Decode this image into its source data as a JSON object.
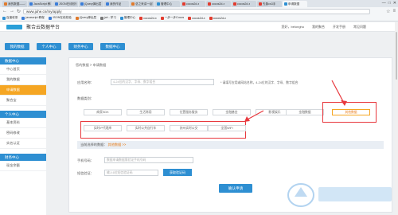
{
  "browser": {
    "tabs": [
      {
        "label": "我的数据——免费在",
        "color": "#e07a2c"
      },
      {
        "label": "JavaScript 教程",
        "color": "#3b7dd8"
      },
      {
        "label": "JSON在线校验",
        "color": "#3b7dd8"
      },
      {
        "label": "jQuery弹出层",
        "color": "#3b7dd8"
      },
      {
        "label": "我的作品",
        "color": "#3b7dd8"
      },
      {
        "label": "总之来讲一起",
        "color": "#e07a2c"
      },
      {
        "label": "管理中心",
        "color": "#2e8fd2"
      },
      {
        "label": "cocos2d-x",
        "color": "#e23b2e"
      },
      {
        "label": "cocos2d-x",
        "color": "#e23b2e"
      },
      {
        "label": "cocos2d-x",
        "color": "#e23b2e"
      },
      {
        "label": "先象cs3手",
        "color": "#e23b2e"
      },
      {
        "label": "申请数据",
        "color": "#2e8fd2"
      }
    ],
    "window_controls": [
      "—",
      "□",
      "✕"
    ],
    "url": "www.juhe.cn/my/apply",
    "bookmarks": [
      {
        "label": "百度收录",
        "color": "#2e8fd2"
      },
      {
        "label": "javascript 教程",
        "color": "#3b7dd8"
      },
      {
        "label": "JSON在线校验",
        "color": "#3b7dd8"
      },
      {
        "label": "jQuery弹出层",
        "color": "#e07a2c"
      },
      {
        "label": "jwt - 学习",
        "color": "#777"
      },
      {
        "label": "管理中心",
        "color": "#2e8fd2"
      },
      {
        "label": "cocos2d-x",
        "color": "#e23b2e"
      },
      {
        "label": "一步一步Cocos",
        "color": "#e23b2e"
      },
      {
        "label": "cocos2d-x",
        "color": "#e23b2e"
      },
      {
        "label": "cocos2d-x",
        "color": "#e23b2e"
      }
    ]
  },
  "site": {
    "name": "聚合云数据平台",
    "user_nav": [
      "您好，belonghu",
      "我的聚合",
      "开发手册",
      "常见问题"
    ]
  },
  "mainnav": [
    "我的数据",
    "个人中心",
    "财务中心",
    "数据中心"
  ],
  "sidebar": {
    "groups": [
      {
        "title": "数据中心",
        "items": [
          "中心首页",
          "我的数据",
          "申请数据",
          "聚合宝"
        ],
        "active": 2
      },
      {
        "title": "个人中心",
        "items": [
          "基本资料",
          "密码修改",
          "实名认证"
        ],
        "active": -1
      },
      {
        "title": "财务中心",
        "items": [
          "现金余额"
        ],
        "active": -1
      }
    ]
  },
  "content": {
    "breadcrumb": "您的数据 > 申请数据",
    "app_name_label": "应用名称：",
    "app_name_placeholder": "4-24位的汉字、字母、数字组合",
    "app_name_hint": "* 请填写应用或网站名称，4-24位的汉字、字母、数字组合",
    "category_label": "数据类别：",
    "categories_row1": [
      "商家SDK",
      "生活常用",
      "位置服务服务",
      "金融基金",
      "影视娱乐",
      "金融数据"
    ],
    "categories_row2": [
      "实时IP代理库",
      "实时公共自行车",
      "苏州实时公交",
      "全国WiFi"
    ],
    "selected_category": "其他数据",
    "selected_prefix": "当前选择的数据：",
    "selected_value": "其他数据 >>",
    "phone_label": "手机号码：",
    "phone_placeholder": "数据申请数据需验证手机号码",
    "code_label": "短信验证：",
    "code_placeholder": "输入6位短信验证码",
    "get_code_label": "获取验证码",
    "submit_label": "确认申请"
  }
}
